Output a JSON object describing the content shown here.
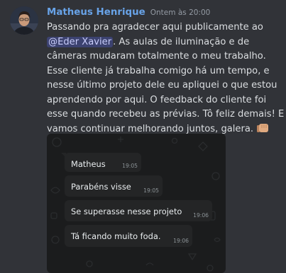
{
  "message": {
    "author": "Matheus Henrique",
    "timestamp": "Ontem às 20:00",
    "lines": [
      "Passando pra agradecer aqui publicamente ao",
      "câmeras mudaram totalmente o meu trabalho.",
      "Esse cliente já trabalha comigo há um tempo, e",
      "nesse último projeto dele eu apliquei o que estou",
      "aprendendo por aqui. O feedback do cliente foi",
      "esse quando recebeu as prévias. Tô feliz demais! E",
      "vamos continuar melhorando juntos, galera."
    ],
    "mention": "@Eder Xavier",
    "after_mention": ". As aulas de iluminação e de",
    "emoji": "fist-bump-emoji"
  },
  "screenshot": {
    "bubbles": [
      {
        "text": "Matheus",
        "time": "19:05"
      },
      {
        "text": "Parabéns visse",
        "time": "19:05"
      },
      {
        "text": "Se superasse nesse projeto",
        "time": "19:06"
      },
      {
        "text": "Tá ficando muito foda.",
        "time": "19:06"
      }
    ]
  },
  "colors": {
    "background": "#313338",
    "author": "#68a3e8",
    "mention_bg": "#3c4270",
    "text": "#dbdee1",
    "chat_bg": "#1b1c1d",
    "bubble_bg": "#242526"
  }
}
